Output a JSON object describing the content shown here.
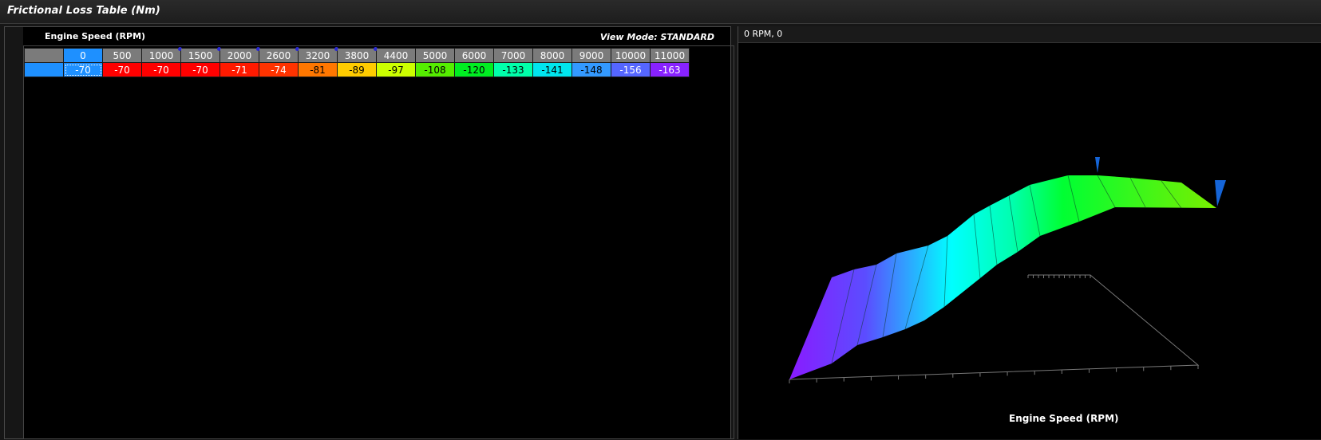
{
  "window": {
    "title": "Frictional Loss Table (Nm)"
  },
  "table": {
    "axis_label": "Engine Speed (RPM)",
    "view_mode": "View Mode: STANDARD",
    "columns": [
      "0",
      "500",
      "1000",
      "1500",
      "2000",
      "2600",
      "3200",
      "3800",
      "4400",
      "5000",
      "6000",
      "7000",
      "8000",
      "9000",
      "10000",
      "11000"
    ],
    "values": [
      "-70",
      "-70",
      "-70",
      "-70",
      "-71",
      "-74",
      "-81",
      "-89",
      "-97",
      "-108",
      "-120",
      "-133",
      "-141",
      "-148",
      "-156",
      "-163"
    ],
    "cell_colors": [
      "#1e90ff",
      "#ff0000",
      "#ff0000",
      "#ff0000",
      "#ff1a00",
      "#ff3300",
      "#ff7700",
      "#ffcc00",
      "#ccff00",
      "#55ee00",
      "#00ee22",
      "#00ffaa",
      "#00e5ee",
      "#3399ff",
      "#5566ff",
      "#8822ff"
    ],
    "text_colors": [
      "#ffffff",
      "#ffffff",
      "#ffffff",
      "#ffffff",
      "#ffffff",
      "#ffffff",
      "#000000",
      "#000000",
      "#000000",
      "#000000",
      "#000000",
      "#000000",
      "#000000",
      "#000000",
      "#ffffff",
      "#ffffff"
    ],
    "marked_columns": [
      "1000",
      "1500",
      "2000",
      "2600",
      "3200",
      "3800"
    ],
    "selected_column": "0"
  },
  "plot": {
    "cursor_readout": "0 RPM, 0",
    "xlabel": "Engine Speed (RPM)"
  }
}
